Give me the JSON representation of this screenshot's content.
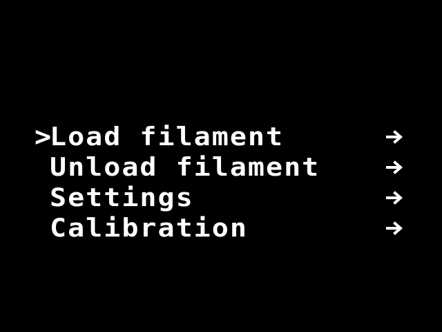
{
  "screen": {
    "background": "#000000",
    "foreground": "#ffffff"
  },
  "menu": {
    "cursor": ">",
    "items": [
      {
        "label": "Load filament",
        "icon": "arrow-right-icon",
        "selected": true
      },
      {
        "label": "Unload filament",
        "icon": "arrow-right-icon",
        "selected": false
      },
      {
        "label": "Settings",
        "icon": "arrow-right-icon",
        "selected": false
      },
      {
        "label": "Calibration",
        "icon": "arrow-right-icon",
        "selected": false
      }
    ]
  }
}
